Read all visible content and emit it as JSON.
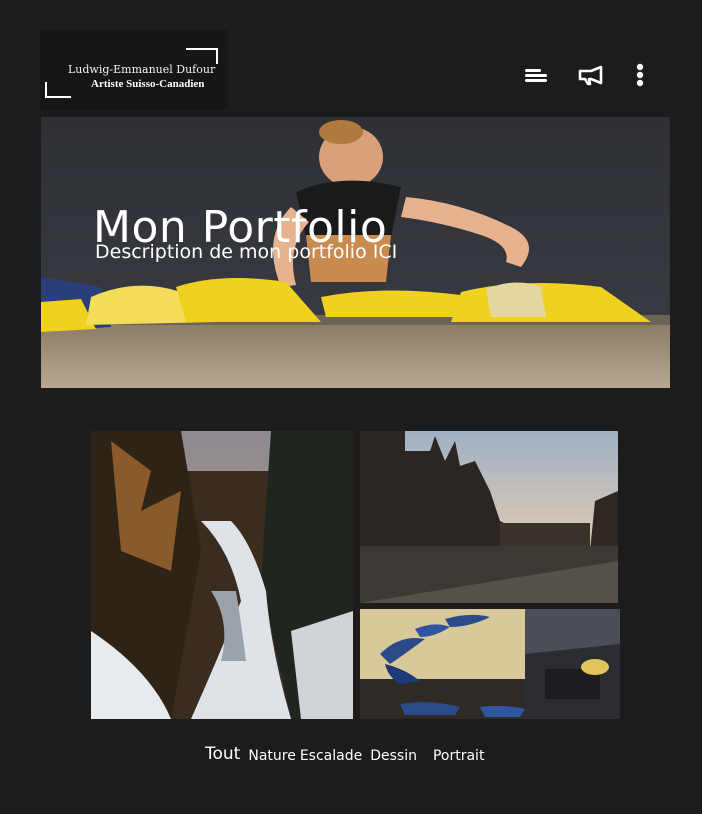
{
  "logo": {
    "name": "Ludwig-Emmanuel Dufour",
    "tagline": "Artiste Suisso-Canadien"
  },
  "nav": {
    "icons": [
      "menu-icon",
      "megaphone-icon",
      "more-vertical-icon"
    ]
  },
  "hero": {
    "title": "Mon Portfolio",
    "description": "Description de mon portfolio ICI"
  },
  "gallery": {
    "photos": [
      "winter-forest-stream",
      "cathedral-square-sunset",
      "climbing-holds-wall"
    ]
  },
  "filters": {
    "items": [
      "Tout",
      "Nature",
      "Escalade",
      "Dessin",
      "Portrait"
    ],
    "active": "Tout"
  },
  "colors": {
    "background": "#1c1c1d",
    "text": "#ffffff",
    "hold_yellow": "#f0d21e"
  }
}
